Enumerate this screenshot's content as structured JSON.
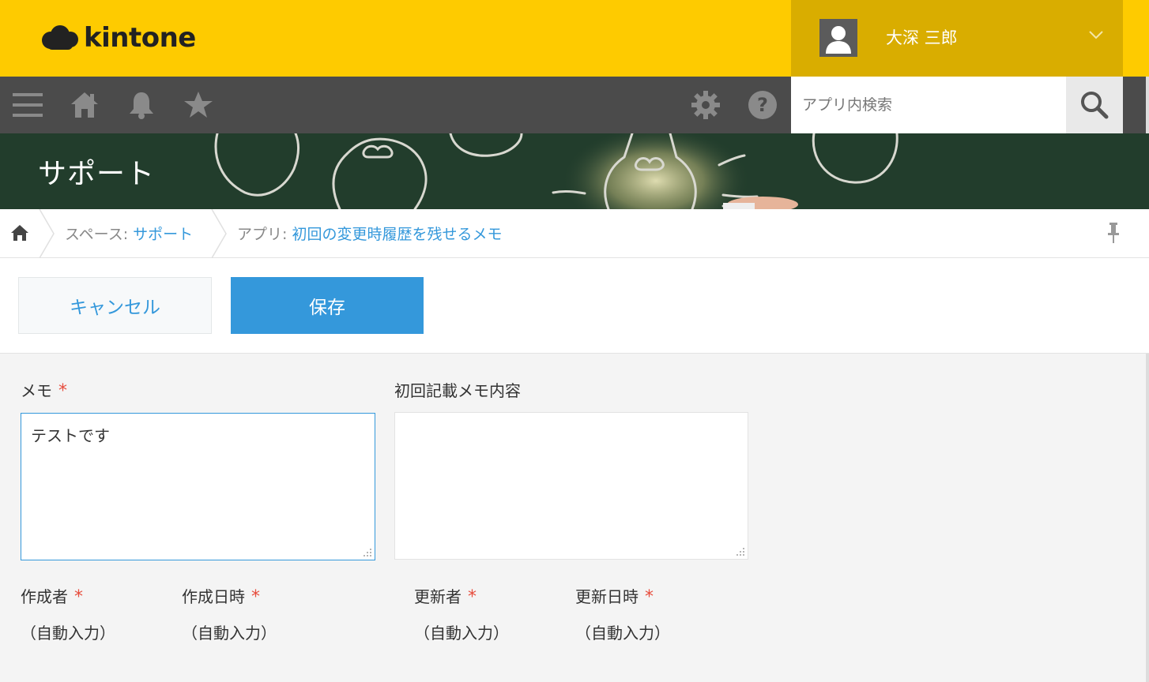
{
  "header": {
    "logo_text": "kintone",
    "user_name": "大深 三郎"
  },
  "toolbar": {
    "search_placeholder": "アプリ内検索",
    "icons": [
      "menu-icon",
      "home-icon",
      "bell-icon",
      "star-icon",
      "gear-icon",
      "help-icon",
      "search-icon"
    ]
  },
  "banner": {
    "title": "サポート"
  },
  "breadcrumb": {
    "space_prefix": "スペース: ",
    "space_name": "サポート",
    "app_prefix": "アプリ: ",
    "app_name": "初回の変更時履歴を残せるメモ"
  },
  "actions": {
    "cancel_label": "キャンセル",
    "save_label": "保存"
  },
  "form": {
    "memo": {
      "label": "メモ",
      "required_mark": "*",
      "value": "テストです"
    },
    "first_memo": {
      "label": "初回記載メモ内容",
      "value": ""
    },
    "creator": {
      "label": "作成者",
      "required_mark": "*",
      "value": "（自動入力）"
    },
    "created_at": {
      "label": "作成日時",
      "required_mark": "*",
      "value": "（自動入力）"
    },
    "updater": {
      "label": "更新者",
      "required_mark": "*",
      "value": "（自動入力）"
    },
    "updated_at": {
      "label": "更新日時",
      "required_mark": "*",
      "value": "（自動入力）"
    }
  },
  "colors": {
    "header_yellow": "#fecb00",
    "user_area": "#d9ad00",
    "toolbar": "#4b4b4b",
    "accent_blue": "#3498db",
    "required_red": "#e74c3c"
  }
}
